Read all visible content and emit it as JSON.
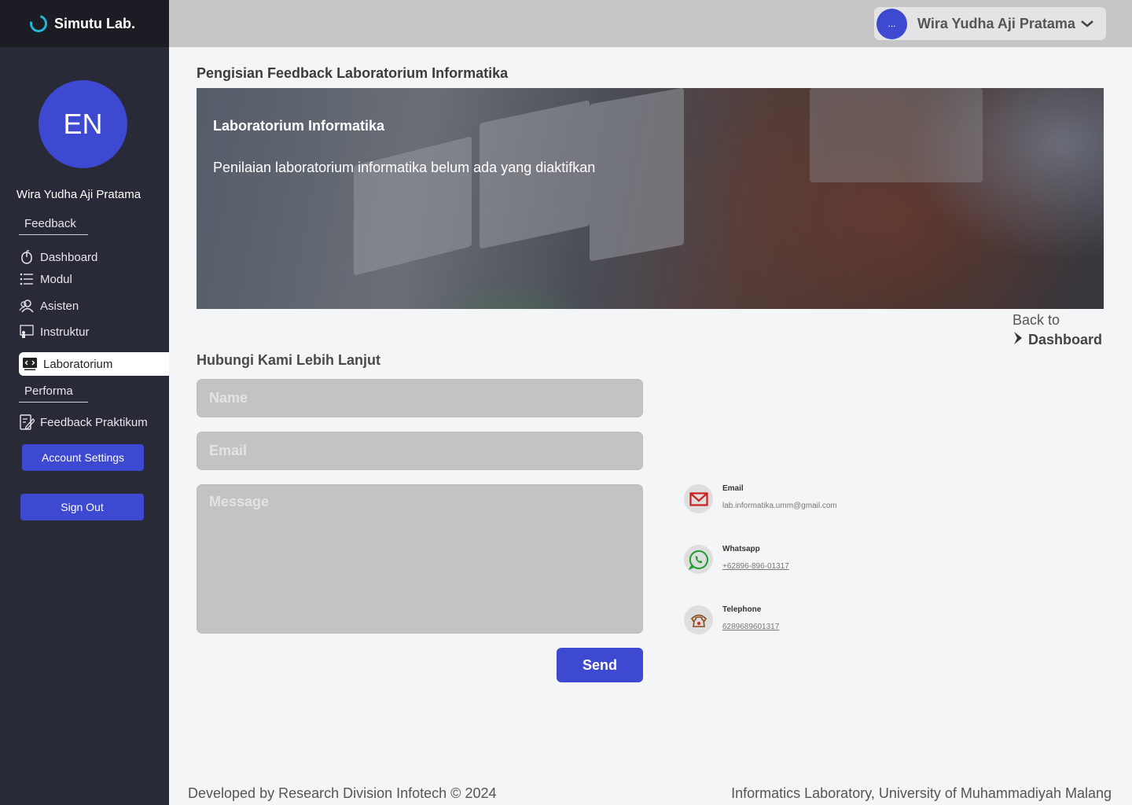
{
  "brand": {
    "name": "Simutu Lab."
  },
  "topbar": {
    "user_initial": "...",
    "user_name": "Wira Yudha Aji Pratama"
  },
  "sidebar": {
    "avatar_initials": "EN",
    "user_name": "Wira Yudha Aji Pratama",
    "section_feedback": "Feedback",
    "items": [
      {
        "label": "Dashboard",
        "icon": "mouse-icon"
      },
      {
        "label": "Modul",
        "icon": "list-icon"
      },
      {
        "label": "Asisten",
        "icon": "users-icon"
      },
      {
        "label": "Instruktur",
        "icon": "instructor-icon"
      },
      {
        "label": "Laboratorium",
        "icon": "code-icon",
        "active": true
      }
    ],
    "section_performa": "Performa",
    "performa_items": [
      {
        "label": "Feedback Praktikum",
        "icon": "edit-icon"
      }
    ],
    "account_settings": "Account Settings",
    "sign_out": "Sign Out"
  },
  "main": {
    "page_title": "Pengisian Feedback Laboratorium Informatika",
    "hero": {
      "title": "Laboratorium Informatika",
      "text": "Penilaian laboratorium informatika belum ada yang diaktifkan"
    },
    "back_to": "Back to",
    "back_target": "Dashboard",
    "contact_heading": "Hubungi Kami Lebih Lanjut",
    "form": {
      "name_placeholder": "Name",
      "email_placeholder": "Email",
      "message_placeholder": "Message",
      "send_label": "Send"
    },
    "contacts": [
      {
        "label": "Email",
        "value": "lab.informatika.umm@gmail.com",
        "icon": "mail-icon",
        "color": "#cc1f1f"
      },
      {
        "label": "Whatsapp",
        "value": "+62896-896-01317",
        "icon": "whatsapp-icon",
        "color": "#1f9e2d"
      },
      {
        "label": "Telephone",
        "value": "6289689601317",
        "icon": "phone-icon",
        "color": "#8a4a1a"
      }
    ]
  },
  "footer": {
    "left": "Developed by Research Division Infotech © 2024",
    "right": "Informatics Laboratory, University of Muhammadiyah Malang"
  },
  "colors": {
    "accent": "#3d49d1",
    "sidebar": "#282a37",
    "topbar": "#c6c6c6"
  }
}
